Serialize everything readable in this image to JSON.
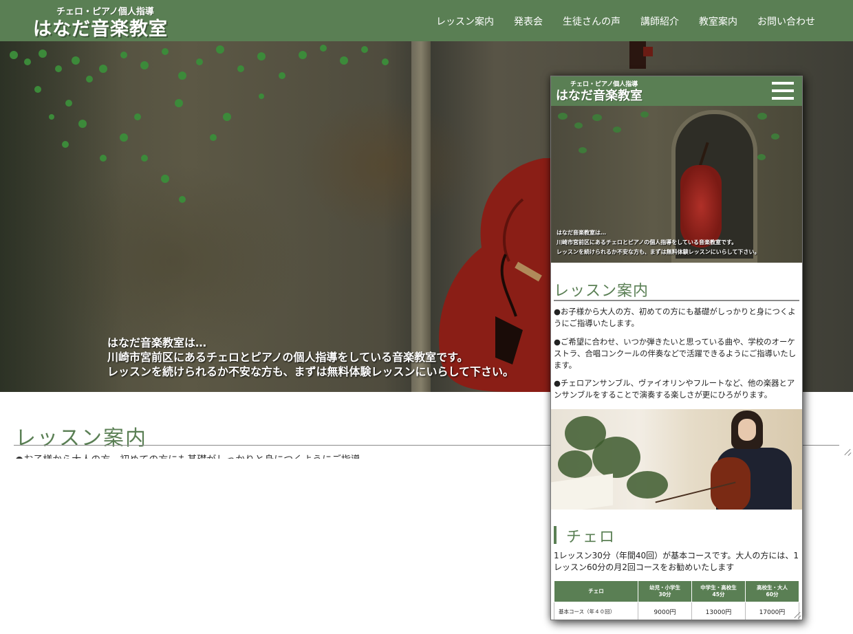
{
  "header": {
    "logo_sub": "チェロ・ピアノ個人指導",
    "logo_main": "はなだ音楽教室",
    "nav": [
      {
        "label": "レッスン案内"
      },
      {
        "label": "発表会"
      },
      {
        "label": "生徒さんの声"
      },
      {
        "label": "講師紹介"
      },
      {
        "label": "教室案内"
      },
      {
        "label": "お問い合わせ"
      }
    ]
  },
  "hero": {
    "line1": "はなだ音楽教室は…",
    "line2": "川崎市宮前区にあるチェロとピアノの個人指導をしている音楽教室です。",
    "line3": "レッスンを続けられるか不安な方も、まずは無料体験レッスンにいらして下さい。"
  },
  "main": {
    "section_title": "レッスン案内",
    "cutoff_text": "●お子様から大人の方、初めての方にも基礎がしっかりと身につくようにご指導いたします。"
  },
  "mobile": {
    "logo_sub": "チェロ・ピアノ個人指導",
    "logo_main": "はなだ音楽教室",
    "hero": {
      "line1": "はなだ音楽教室は…",
      "line2": "川崎市宮前区にあるチェロとピアノの個人指導をしている音楽教室です。",
      "line3": "レッスンを続けられるか不安な方も、まずは無料体験レッスンにいらして下さい。"
    },
    "section_title": "レッスン案内",
    "paragraphs": [
      "●お子様から大人の方、初めての方にも基礎がしっかりと身につくようにご指導いたします。",
      "●ご希望に合わせ、いつか弾きたいと思っている曲や、学校のオーケストラ、合唱コンクールの伴奏などで活躍できるようにご指導いたします。",
      "●チェロアンサンブル、ヴァイオリンやフルートなど、他の楽器とアンサンブルをすることで演奏する楽しさが更にひろがります。"
    ],
    "sub_title": "チェロ",
    "sub_paragraph": "1レッスン30分（年間40回）が基本コースです。大人の方には、1レッスン60分の月2回コースをお勧めいたします",
    "table": {
      "headers": [
        {
          "line1": "チェロ",
          "line2": ""
        },
        {
          "line1": "幼児・小学生",
          "line2": "30分"
        },
        {
          "line1": "中学生・高校生",
          "line2": "45分"
        },
        {
          "line1": "高校生・大人",
          "line2": "60分"
        }
      ],
      "rows": [
        [
          "基本コース（年４０回）",
          "9000円",
          "13000円",
          "17000円"
        ]
      ]
    }
  }
}
